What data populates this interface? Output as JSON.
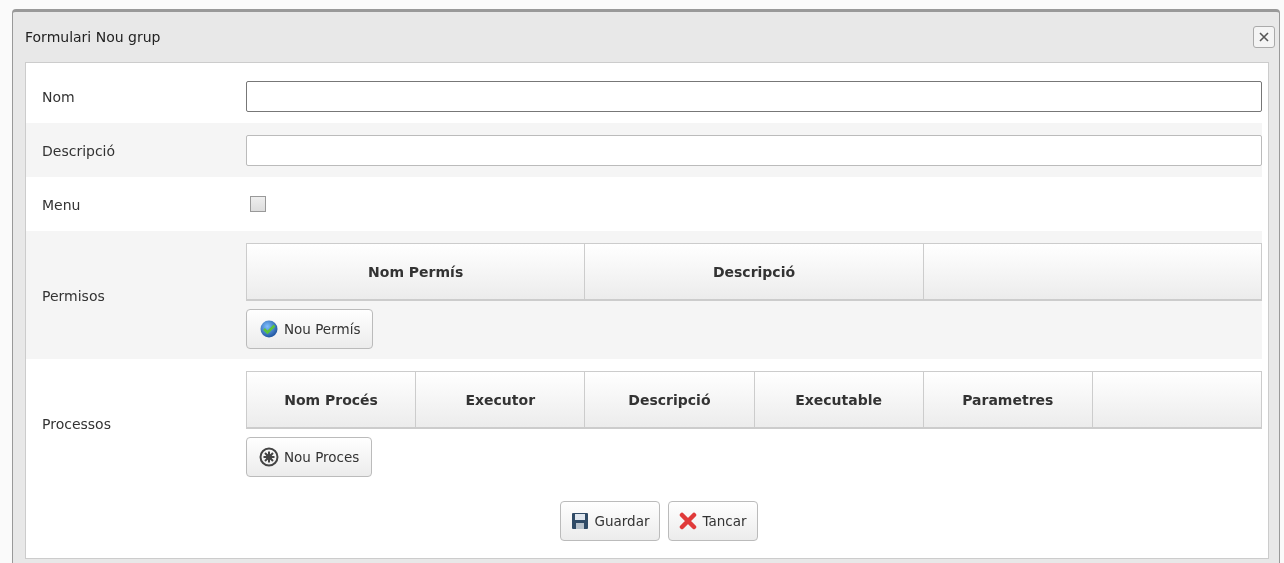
{
  "window": {
    "title": "Formulari Nou grup"
  },
  "rows": [
    {
      "kind": "text",
      "label": "Nom",
      "focused": true
    },
    {
      "kind": "text",
      "label": "Descripció",
      "focused": false
    },
    {
      "kind": "checkbox",
      "label": "Menu",
      "checked": false
    },
    {
      "kind": "table",
      "label": "Permisos",
      "columns": [
        "Nom Permís",
        "Descripció"
      ],
      "button": {
        "label": "Nou Permís",
        "kind": "check"
      }
    },
    {
      "kind": "table",
      "label": "Processos",
      "columns": [
        "Nom Procés",
        "Executor",
        "Descripció",
        "Executable",
        "Parametres"
      ],
      "button": {
        "label": "Nou Proces",
        "kind": "gear"
      }
    }
  ],
  "buttons": [
    {
      "label": "Guardar",
      "kind": "save"
    },
    {
      "label": "Tancar",
      "kind": "cancel"
    }
  ]
}
